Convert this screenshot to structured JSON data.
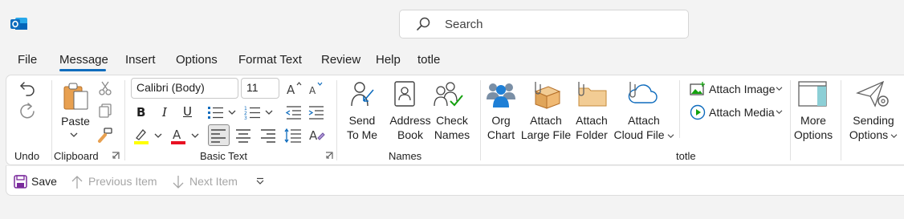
{
  "search": {
    "placeholder": "Search"
  },
  "menu": {
    "tabs": [
      {
        "label": "File"
      },
      {
        "label": "Message"
      },
      {
        "label": "Insert"
      },
      {
        "label": "Options"
      },
      {
        "label": "Format Text"
      },
      {
        "label": "Review"
      },
      {
        "label": "Help"
      },
      {
        "label": "totle"
      }
    ],
    "active": "Message"
  },
  "groups": {
    "undo": {
      "label": "Undo"
    },
    "clipboard": {
      "label": "Clipboard",
      "paste": "Paste"
    },
    "basic_text": {
      "label": "Basic Text",
      "font_name": "Calibri (Body)",
      "font_size": "11"
    },
    "names": {
      "label": "Names",
      "send_to_me": [
        "Send",
        "To Me"
      ],
      "address_book": [
        "Address",
        "Book"
      ],
      "check_names": [
        "Check",
        "Names"
      ]
    },
    "totle": {
      "label": "totle",
      "org_chart": [
        "Org",
        "Chart"
      ],
      "attach_large": [
        "Attach",
        "Large File"
      ],
      "attach_folder": [
        "Attach",
        "Folder"
      ],
      "attach_cloud": [
        "Attach",
        "Cloud File"
      ],
      "attach_image": "Attach Image",
      "attach_media": "Attach Media",
      "more_options": [
        "More",
        "Options"
      ],
      "sending_options": [
        "Sending",
        "Options"
      ]
    }
  },
  "qat": {
    "save": "Save",
    "previous": "Previous Item",
    "next": "Next Item"
  },
  "colors": {
    "accent": "#0f6cbd",
    "highlight_yellow": "#ffff00",
    "font_red": "#e81123"
  }
}
